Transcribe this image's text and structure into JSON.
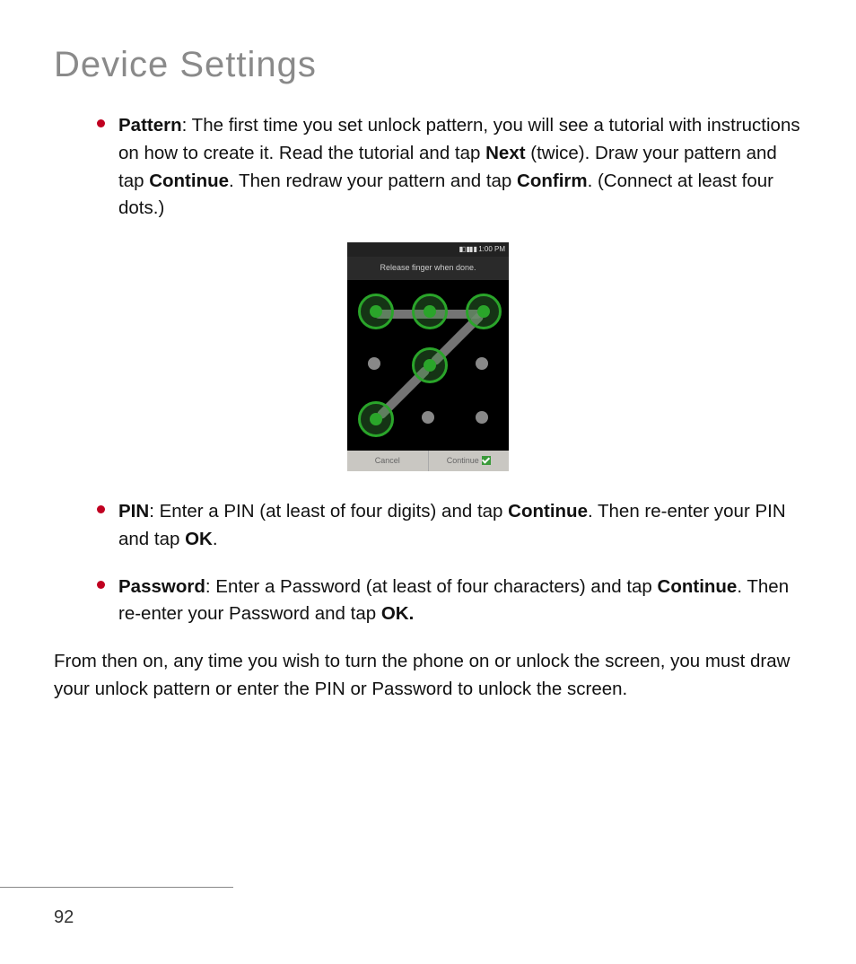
{
  "title": "Device Settings",
  "bullets": {
    "pattern": {
      "label": "Pattern",
      "sep": ": ",
      "t1": "The first time you set unlock pattern, you will see a tutorial with instructions on how to create it. Read the tutorial and tap ",
      "b1": "Next",
      "t2": " (twice). Draw your pattern and tap ",
      "b2": "Continue",
      "t3": ". Then redraw your pattern and tap ",
      "b3": "Confirm",
      "t4": ". (Connect at least four dots.)"
    },
    "pin": {
      "label": "PIN",
      "sep": ": ",
      "t1": "Enter a PIN (at least of four digits) and tap ",
      "b1": "Continue",
      "t2": ". Then re-enter your PIN and tap ",
      "b2": "OK",
      "t3": "."
    },
    "password": {
      "label": "Password",
      "sep": ": ",
      "t1": "Enter a Password (at least of four characters) and tap ",
      "b1": "Continue",
      "t2": ". Then re-enter your Password and tap ",
      "b2": "OK.",
      "t3": ""
    }
  },
  "closing": "From then on, any time you wish to turn the phone on or unlock the screen, you must draw your unlock pattern or enter the PIN or Password to unlock the screen.",
  "phone": {
    "time": "1:00 PM",
    "instruction": "Release finger when done.",
    "cancel": "Cancel",
    "continue": "Continue",
    "pattern_selected": [
      0,
      1,
      2,
      4,
      6
    ],
    "grid_size": 3
  },
  "page_number": "92"
}
